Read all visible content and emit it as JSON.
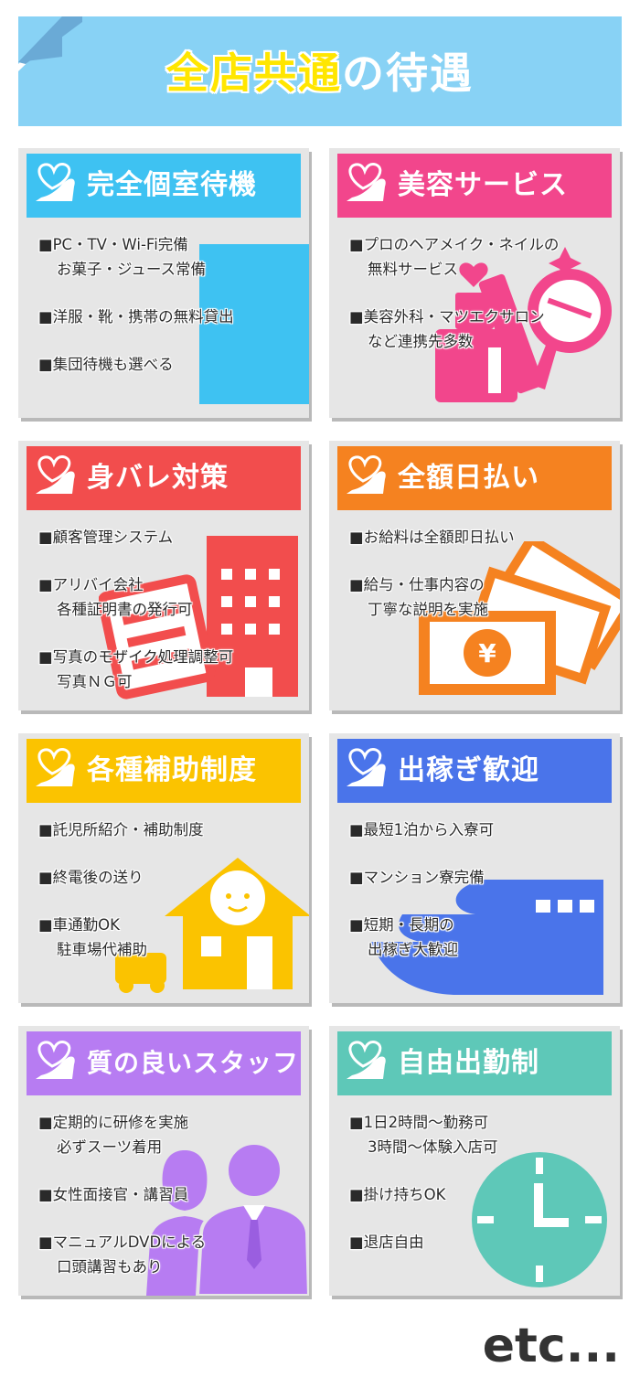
{
  "header": {
    "title_highlight": "全店共通",
    "title_rest": "の待遇",
    "bg_color": "#88d2f5",
    "highlight_color": "#ffe600"
  },
  "cards": [
    {
      "title": "完全個室待機",
      "color": "#3ec2f2",
      "icon": "bench-icon",
      "items": [
        {
          "line1": "■PC・TV・Wi-Fi完備",
          "line2": "お菓子・ジュース常備"
        },
        {
          "line1": "■洋服・靴・携帯の無料貸出",
          "line2": ""
        },
        {
          "line1": "■集団待機も選べる",
          "line2": ""
        }
      ]
    },
    {
      "title": "美容サービス",
      "color": "#f2468c",
      "icon": "cosmetics-icon",
      "items": [
        {
          "line1": "■プロのヘアメイク・ネイルの",
          "line2": "無料サービス"
        },
        {
          "line1": "■美容外科・マツエクサロン",
          "line2": "など連携先多数"
        }
      ]
    },
    {
      "title": "身バレ対策",
      "color": "#f24d4d",
      "icon": "building-icon",
      "items": [
        {
          "line1": "■顧客管理システム",
          "line2": ""
        },
        {
          "line1": "■アリバイ会社",
          "line2": "各種証明書の発行可"
        },
        {
          "line1": "■写真のモザイク処理調整可",
          "line2": "写真ＮＧ可"
        }
      ]
    },
    {
      "title": "全額日払い",
      "color": "#f58220",
      "icon": "yen-bill-icon",
      "items": [
        {
          "line1": "■お給料は全額即日払い",
          "line2": ""
        },
        {
          "line1": "■給与・仕事内容の",
          "line2": "丁寧な説明を実施"
        }
      ]
    },
    {
      "title": "各種補助制度",
      "color": "#fbc300",
      "icon": "house-child-icon",
      "items": [
        {
          "line1": "■託児所紹介・補助制度",
          "line2": ""
        },
        {
          "line1": "■終電後の送り",
          "line2": ""
        },
        {
          "line1": "■車通勤OK",
          "line2": "駐車場代補助"
        }
      ]
    },
    {
      "title": "出稼ぎ歓迎",
      "color": "#4a74ea",
      "icon": "bullet-train-icon",
      "items": [
        {
          "line1": "■最短1泊から入寮可",
          "line2": ""
        },
        {
          "line1": "■マンション寮完備",
          "line2": ""
        },
        {
          "line1": "■短期・長期の",
          "line2": "出稼ぎ大歓迎"
        }
      ]
    },
    {
      "title": "質の良いスタッフ",
      "color": "#b77cf2",
      "icon": "staff-icon",
      "items": [
        {
          "line1": "■定期的に研修を実施",
          "line2": "必ずスーツ着用"
        },
        {
          "line1": "■女性面接官・講習員",
          "line2": ""
        },
        {
          "line1": "■マニュアルDVDによる",
          "line2": "口頭講習もあり"
        }
      ]
    },
    {
      "title": "自由出勤制",
      "color": "#5ec8b8",
      "icon": "clock-icon",
      "items": [
        {
          "line1": "■1日2時間～勤務可",
          "line2": "3時間～体験入店可"
        },
        {
          "line1": "■掛け持ちOK",
          "line2": ""
        },
        {
          "line1": "■退店自由",
          "line2": ""
        }
      ]
    }
  ],
  "footer": {
    "etc": "etc..."
  }
}
